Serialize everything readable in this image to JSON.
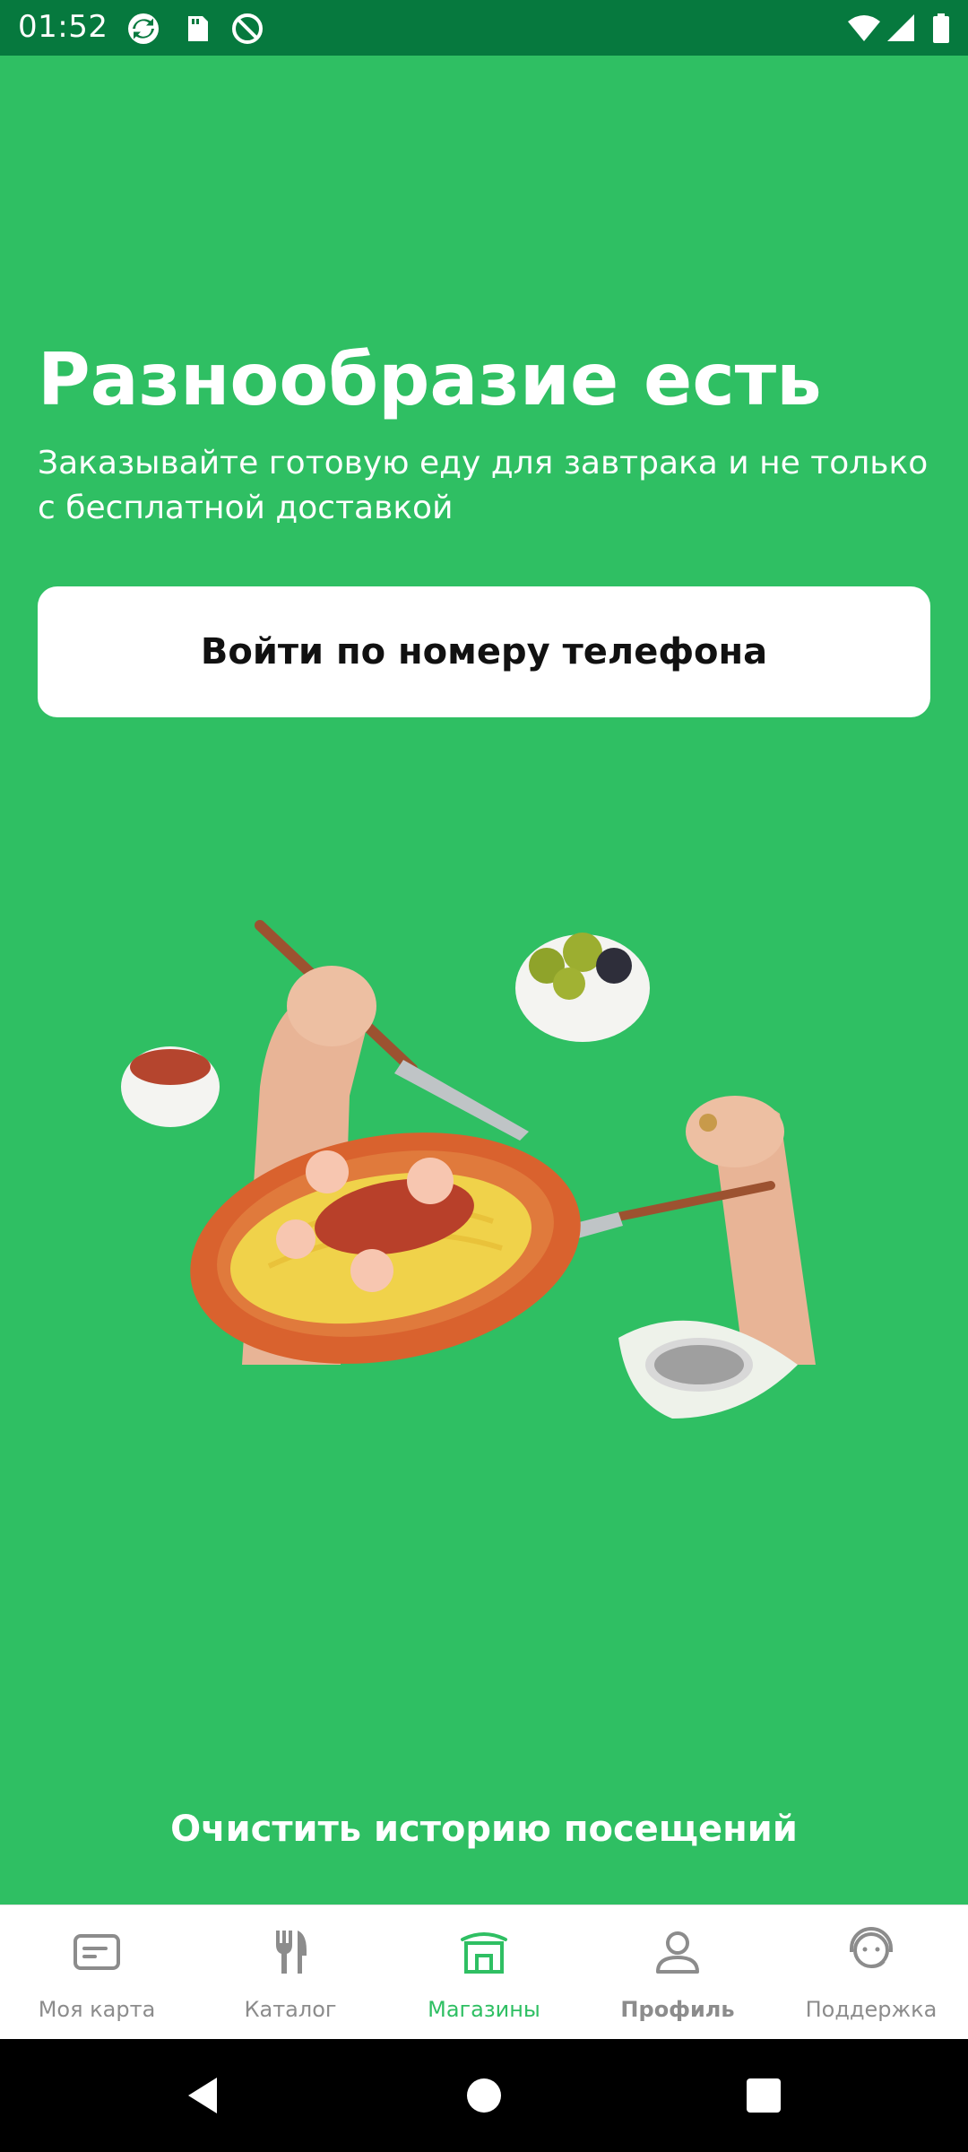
{
  "status_bar": {
    "time": "01:52",
    "icons": [
      "sync-icon",
      "sd-card-icon",
      "no-disturb-icon",
      "wifi-icon",
      "signal-icon",
      "battery-icon"
    ]
  },
  "hero": {
    "title": "Разнообразие есть",
    "subtitle": "Заказывайте готовую еду для завтрака и не только с бесплатной доставкой"
  },
  "login_button": {
    "label": "Войти по номеру телефона"
  },
  "illustration": {
    "icon": "food-illustration"
  },
  "clear_history": {
    "label": "Очистить историю посещений"
  },
  "bottom_nav": {
    "items": [
      {
        "label": "Моя карта",
        "icon": "card-icon",
        "state": "inactive"
      },
      {
        "label": "Каталог",
        "icon": "fork-knife-icon",
        "state": "inactive"
      },
      {
        "label": "Магазины",
        "icon": "store-icon",
        "state": "active"
      },
      {
        "label": "Профиль",
        "icon": "profile-icon",
        "state": "bold"
      },
      {
        "label": "Поддержка",
        "icon": "support-icon",
        "state": "inactive"
      }
    ]
  },
  "system_nav": {
    "buttons": [
      "back-icon",
      "home-icon",
      "recents-icon"
    ]
  },
  "colors": {
    "brand_green": "#2fbf63",
    "status_bar": "#06793e",
    "nav_inactive": "#8c8c8c"
  }
}
